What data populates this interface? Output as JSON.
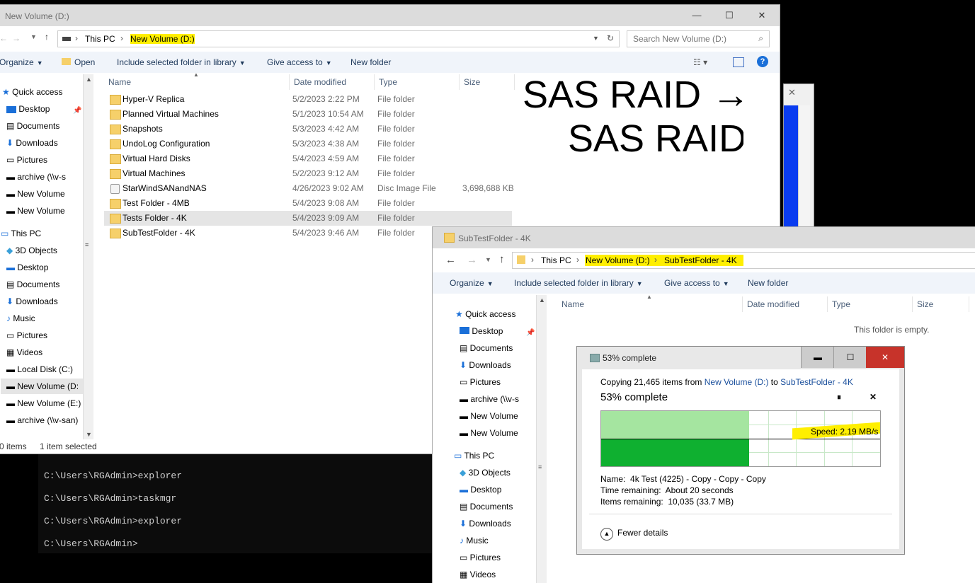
{
  "console": {
    "lines": [
      "C:\\Users\\RGAdmin>explorer",
      "C:\\Users\\RGAdmin>taskmgr",
      "C:\\Users\\RGAdmin>explorer",
      "C:\\Users\\RGAdmin>"
    ]
  },
  "main_explorer": {
    "title": "New Volume (D:)",
    "breadcrumb": [
      "This PC",
      "New Volume (D:)"
    ],
    "search_placeholder": "Search New Volume (D:)",
    "toolbar": {
      "organize": "Organize",
      "open": "Open",
      "include": "Include selected folder in library",
      "give_access": "Give access to",
      "new_folder": "New folder"
    },
    "columns": {
      "name": "Name",
      "date": "Date modified",
      "type": "Type",
      "size": "Size"
    },
    "files": [
      {
        "name": "Hyper-V Replica",
        "date": "5/2/2023 2:22 PM",
        "type": "File folder",
        "size": ""
      },
      {
        "name": "Planned Virtual Machines",
        "date": "5/1/2023 10:54 AM",
        "type": "File folder",
        "size": ""
      },
      {
        "name": "Snapshots",
        "date": "5/3/2023 4:42 AM",
        "type": "File folder",
        "size": ""
      },
      {
        "name": "UndoLog Configuration",
        "date": "5/3/2023 4:38 AM",
        "type": "File folder",
        "size": ""
      },
      {
        "name": "Virtual Hard Disks",
        "date": "5/4/2023 4:59 AM",
        "type": "File folder",
        "size": ""
      },
      {
        "name": "Virtual Machines",
        "date": "5/2/2023 9:12 AM",
        "type": "File folder",
        "size": ""
      },
      {
        "name": "StarWindSANandNAS",
        "date": "4/26/2023 9:02 AM",
        "type": "Disc Image File",
        "size": "3,698,688 KB"
      },
      {
        "name": "Test Folder - 4MB",
        "date": "5/4/2023 9:08 AM",
        "type": "File folder",
        "size": ""
      },
      {
        "name": "Tests Folder - 4K",
        "date": "5/4/2023 9:09 AM",
        "type": "File folder",
        "size": ""
      },
      {
        "name": "SubTestFolder - 4K",
        "date": "5/4/2023 9:46 AM",
        "type": "File folder",
        "size": ""
      }
    ],
    "nav": [
      "Quick access",
      "Desktop",
      "Documents",
      "Downloads",
      "Pictures",
      "archive (\\\\v-s",
      "New Volume",
      "New Volume",
      "This PC",
      "3D Objects",
      "Desktop",
      "Documents",
      "Downloads",
      "Music",
      "Pictures",
      "Videos",
      "Local Disk (C:)",
      "New Volume (D:",
      "New Volume (E:)",
      "archive (\\\\v-san)"
    ],
    "status": {
      "items": "0 items",
      "selected": "1 item selected"
    }
  },
  "handwriting": {
    "line1": "SAS RAID →",
    "line2": "SAS RAID"
  },
  "sub_explorer": {
    "title": "SubTestFolder - 4K",
    "breadcrumb": [
      "This PC",
      "New Volume (D:)",
      "SubTestFolder - 4K"
    ],
    "toolbar": {
      "organize": "Organize",
      "include": "Include selected folder in library",
      "give_access": "Give access to",
      "new_folder": "New folder"
    },
    "columns": {
      "name": "Name",
      "date": "Date modified",
      "type": "Type",
      "size": "Size"
    },
    "empty": "This folder is empty.",
    "nav": [
      "Quick access",
      "Desktop",
      "Documents",
      "Downloads",
      "Pictures",
      "archive (\\\\v-s",
      "New Volume",
      "New Volume",
      "This PC",
      "3D Objects",
      "Desktop",
      "Documents",
      "Downloads",
      "Music",
      "Pictures",
      "Videos"
    ]
  },
  "copy_dialog": {
    "title": "53% complete",
    "copying_prefix": "Copying 21,465 items from ",
    "source": "New Volume (D:)",
    "to": " to ",
    "dest": "SubTestFolder - 4K",
    "percent_label": "53% complete",
    "progress": 0.53,
    "speed": "Speed: 2.19 MB/s",
    "name_label": "Name:",
    "name_value": "4k Test (4225) - Copy - Copy - Copy",
    "time_label": "Time remaining:",
    "time_value": "About 20 seconds",
    "items_label": "Items remaining:",
    "items_value": "10,035 (33.7 MB)",
    "fewer_details": "Fewer details"
  },
  "colors": {
    "progress_fill": "#a5e5a0",
    "progress_dark": "#0fb030",
    "highlight": "#ffef00",
    "link": "#1a4f9c"
  }
}
